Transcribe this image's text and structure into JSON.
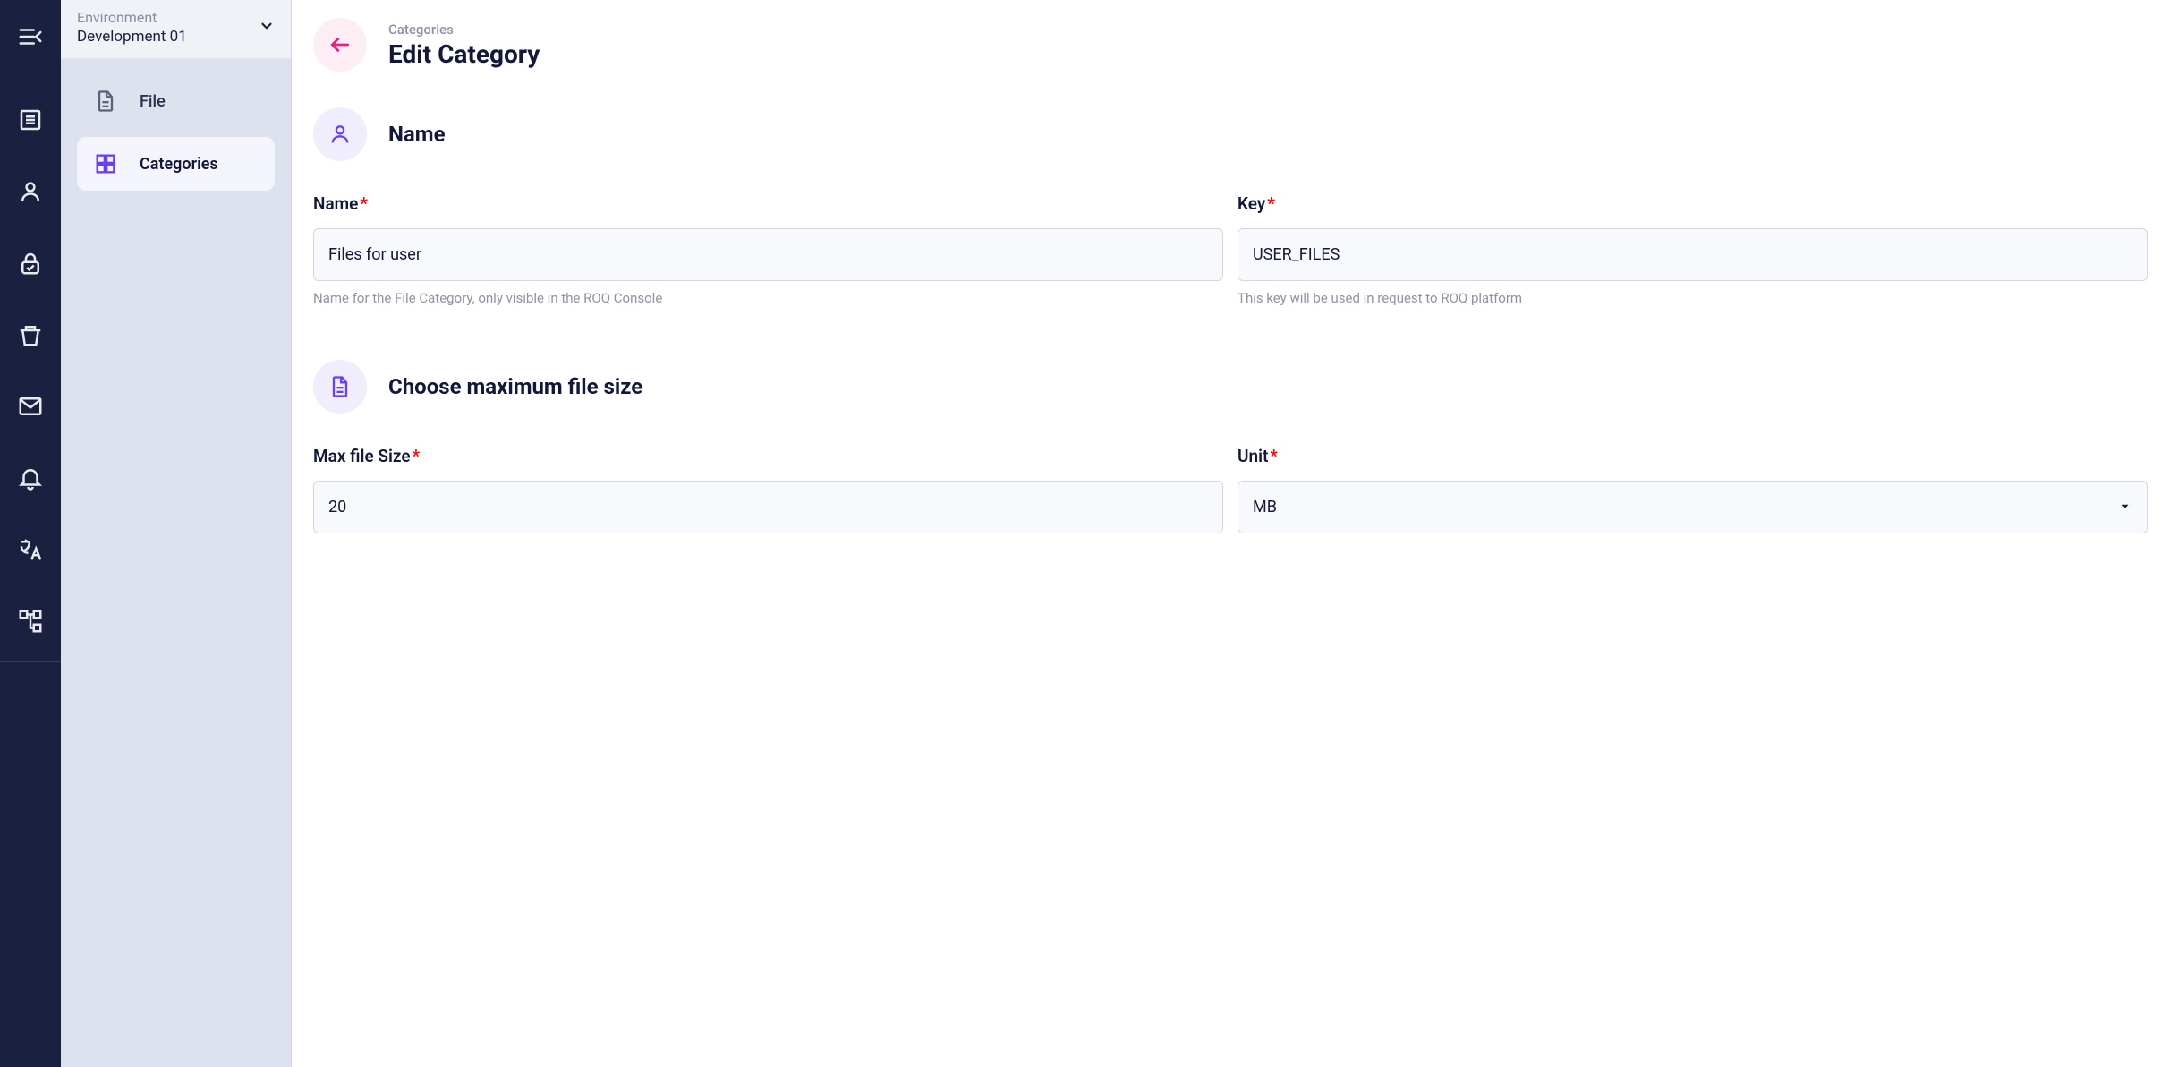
{
  "env": {
    "label": "Environment",
    "value": "Development 01"
  },
  "sidebar": {
    "items": [
      {
        "label": "File"
      },
      {
        "label": "Categories"
      }
    ]
  },
  "header": {
    "breadcrumb": "Categories",
    "title": "Edit Category"
  },
  "sections": {
    "name": {
      "title": "Name",
      "fields": {
        "name": {
          "label": "Name",
          "value": "Files for user",
          "helper": "Name for the File Category, only visible in the ROQ Console"
        },
        "key": {
          "label": "Key",
          "value": "USER_FILES",
          "helper": "This key will be used in request to ROQ platform"
        }
      }
    },
    "size": {
      "title": "Choose maximum file size",
      "fields": {
        "max": {
          "label": "Max file Size",
          "value": "20"
        },
        "unit": {
          "label": "Unit",
          "value": "MB"
        }
      }
    }
  }
}
